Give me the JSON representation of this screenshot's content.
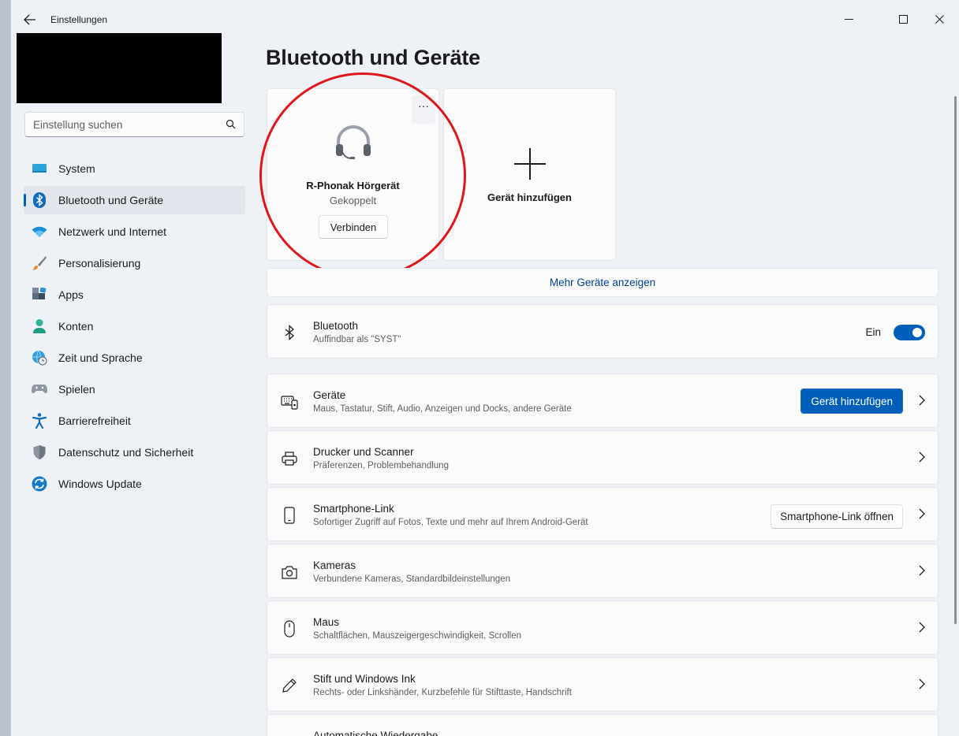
{
  "window": {
    "title": "Einstellungen"
  },
  "sidebar": {
    "search_placeholder": "Einstellung suchen",
    "items": [
      {
        "label": "System",
        "icon": "monitor-icon",
        "active": false
      },
      {
        "label": "Bluetooth und Geräte",
        "icon": "bluetooth-icon",
        "active": true
      },
      {
        "label": "Netzwerk und Internet",
        "icon": "wifi-icon",
        "active": false
      },
      {
        "label": "Personalisierung",
        "icon": "brush-icon",
        "active": false
      },
      {
        "label": "Apps",
        "icon": "apps-icon",
        "active": false
      },
      {
        "label": "Konten",
        "icon": "person-icon",
        "active": false
      },
      {
        "label": "Zeit und Sprache",
        "icon": "globe-clock-icon",
        "active": false
      },
      {
        "label": "Spielen",
        "icon": "gamepad-icon",
        "active": false
      },
      {
        "label": "Barrierefreiheit",
        "icon": "accessibility-icon",
        "active": false
      },
      {
        "label": "Datenschutz und Sicherheit",
        "icon": "shield-icon",
        "active": false
      },
      {
        "label": "Windows Update",
        "icon": "update-icon",
        "active": false
      }
    ]
  },
  "main": {
    "title": "Bluetooth und Geräte",
    "device_card": {
      "name": "R-Phonak Hörgerät",
      "status": "Gekoppelt",
      "connect_label": "Verbinden",
      "more_label": "···"
    },
    "add_card": {
      "label": "Gerät hinzufügen"
    },
    "more_devices_label": "Mehr Geräte anzeigen",
    "bluetooth": {
      "title": "Bluetooth",
      "subtitle": "Auffindbar als \"SYST\"",
      "toggle_label": "Ein",
      "toggle_on": true
    },
    "rows": [
      {
        "title": "Geräte",
        "subtitle": "Maus, Tastatur, Stift, Audio, Anzeigen und Docks, andere Geräte",
        "button": "Gerät hinzufügen"
      },
      {
        "title": "Drucker und Scanner",
        "subtitle": "Präferenzen, Problembehandlung"
      },
      {
        "title": "Smartphone-Link",
        "subtitle": "Sofortiger Zugriff auf Fotos, Texte und mehr auf Ihrem Android-Gerät",
        "button": "Smartphone-Link öffnen"
      },
      {
        "title": "Kameras",
        "subtitle": "Verbundene Kameras, Standardbildeinstellungen"
      },
      {
        "title": "Maus",
        "subtitle": "Schaltflächen, Mauszeigergeschwindigkeit, Scrollen"
      },
      {
        "title": "Stift und Windows Ink",
        "subtitle": "Rechts- oder Linkshänder, Kurzbefehle für Stifttaste, Handschrift"
      },
      {
        "title": "Automatische Wiedergabe",
        "subtitle": ""
      }
    ]
  },
  "colors": {
    "accent": "#005fb8",
    "annotation_circle": "#e0161b"
  }
}
